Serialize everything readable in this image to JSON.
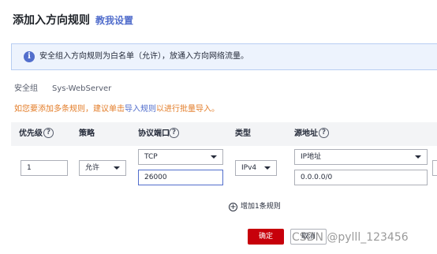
{
  "header": {
    "title": "添加入方向规则",
    "help_link": "教我设置"
  },
  "notice": {
    "icon": "info-icon",
    "text": "安全组入方向规则为白名单（允许），放通入方向网络流量。"
  },
  "security_group": {
    "label": "安全组",
    "value": "Sys-WebServer"
  },
  "tip": {
    "prefix": "如您要添加多条规则，建议单击",
    "link": "导入规则",
    "suffix": "以进行批量导入。"
  },
  "table": {
    "columns": {
      "priority": "优先级",
      "policy": "策略",
      "protocol_port": "协议端口",
      "type": "类型",
      "source": "源地址"
    }
  },
  "row": {
    "priority": "1",
    "policy": "允许",
    "protocol": "TCP",
    "port": "26000",
    "type": "IPv4",
    "source_type": "IP地址",
    "source_address": "0.0.0.0/0"
  },
  "add_rule": {
    "label": "增加1条规则"
  },
  "footer": {
    "confirm": "确定",
    "cancel": "取消"
  },
  "watermark": "CSDN @pylll_123456",
  "colors": {
    "accent": "#526ecc",
    "primary_button": "#c7000b",
    "warning_text": "#e37d29",
    "notice_bg": "#edf3fd"
  }
}
